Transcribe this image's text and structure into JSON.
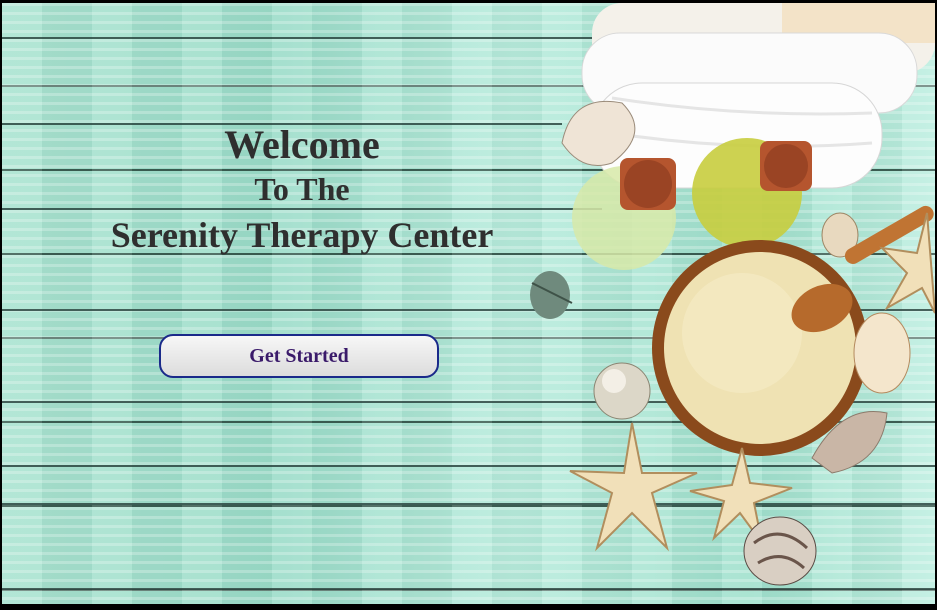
{
  "hero": {
    "line1": "Welcome",
    "line2": "To The",
    "line3": "Serenity Therapy Center"
  },
  "cta": {
    "label": "Get Started"
  },
  "colors": {
    "background": "#a9e3d0",
    "heading_text": "#2f2f2f",
    "button_border": "#1a2a8a",
    "button_text": "#3a1a6a"
  },
  "decor": {
    "icons": [
      "towel-icon",
      "oil-bottle-icon",
      "salt-bowl-icon",
      "wooden-spoon-icon",
      "starfish-icon",
      "seashell-icon"
    ]
  }
}
